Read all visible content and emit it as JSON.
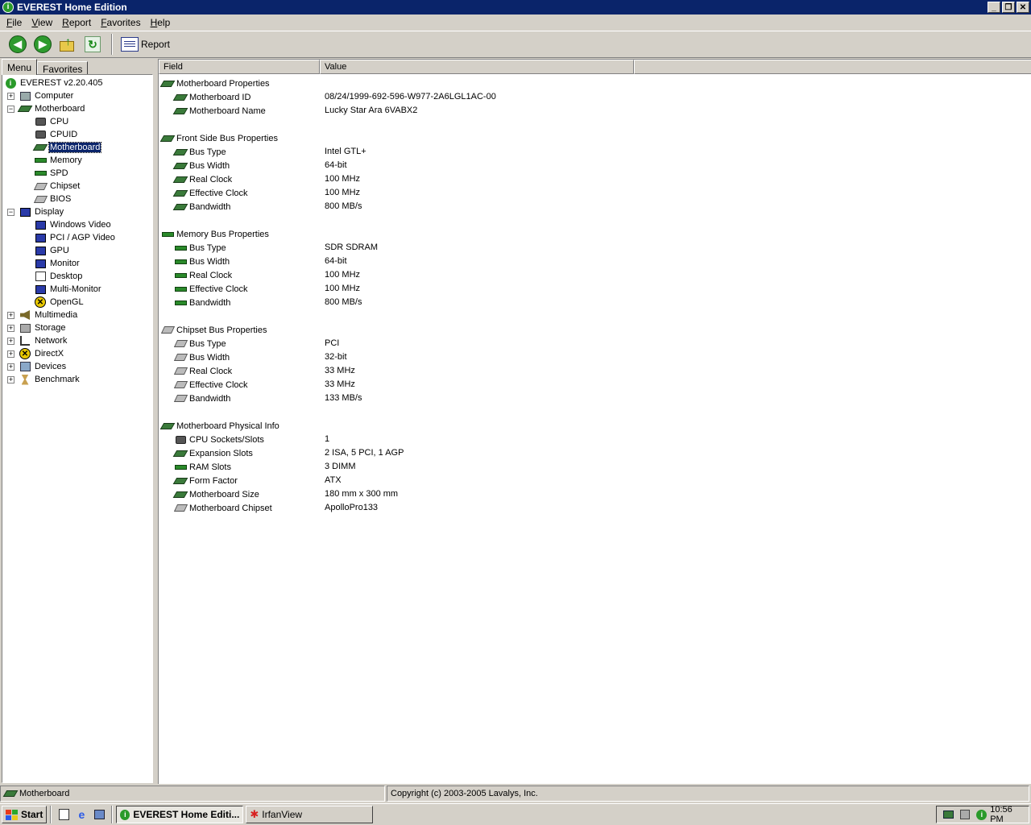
{
  "window": {
    "title": "EVEREST Home Edition"
  },
  "menu": [
    "File",
    "View",
    "Report",
    "Favorites",
    "Help"
  ],
  "toolbar": {
    "report_label": "Report"
  },
  "tabs": {
    "menu": "Menu",
    "favorites": "Favorites"
  },
  "tree": [
    {
      "label": "EVEREST v2.20.405",
      "icon": "info-icon"
    },
    {
      "label": "Computer",
      "icon": "computer-icon"
    },
    {
      "label": "Motherboard",
      "icon": "motherboard-icon"
    },
    {
      "label": "CPU",
      "icon": "cpu-icon"
    },
    {
      "label": "CPUID",
      "icon": "cpu-icon"
    },
    {
      "label": "Motherboard",
      "icon": "motherboard-icon"
    },
    {
      "label": "Memory",
      "icon": "ram-icon"
    },
    {
      "label": "SPD",
      "icon": "ram-icon"
    },
    {
      "label": "Chipset",
      "icon": "chipset-icon"
    },
    {
      "label": "BIOS",
      "icon": "chipset-icon"
    },
    {
      "label": "Display",
      "icon": "display-icon"
    },
    {
      "label": "Windows Video",
      "icon": "display-icon"
    },
    {
      "label": "PCI / AGP Video",
      "icon": "display-icon"
    },
    {
      "label": "GPU",
      "icon": "display-icon"
    },
    {
      "label": "Monitor",
      "icon": "display-icon"
    },
    {
      "label": "Desktop",
      "icon": "desktop-icon"
    },
    {
      "label": "Multi-Monitor",
      "icon": "display-icon"
    },
    {
      "label": "OpenGL",
      "icon": "opengl-icon"
    },
    {
      "label": "Multimedia",
      "icon": "speaker-icon"
    },
    {
      "label": "Storage",
      "icon": "storage-icon"
    },
    {
      "label": "Network",
      "icon": "network-icon"
    },
    {
      "label": "DirectX",
      "icon": "directx-icon"
    },
    {
      "label": "Devices",
      "icon": "devices-icon"
    },
    {
      "label": "Benchmark",
      "icon": "hourglass-icon"
    }
  ],
  "list": {
    "columns": [
      "Field",
      "Value"
    ],
    "rows": [
      {
        "field": "Motherboard Properties",
        "value": "",
        "icon": "motherboard-icon"
      },
      {
        "field": "Motherboard ID",
        "value": "08/24/1999-692-596-W977-2A6LGL1AC-00",
        "icon": "motherboard-icon"
      },
      {
        "field": "Motherboard Name",
        "value": "Lucky Star Ara 6VABX2",
        "icon": "motherboard-icon"
      },
      {
        "field": "Front Side Bus Properties",
        "value": "",
        "icon": "motherboard-icon"
      },
      {
        "field": "Bus Type",
        "value": "Intel GTL+",
        "icon": "motherboard-icon"
      },
      {
        "field": "Bus Width",
        "value": "64-bit",
        "icon": "motherboard-icon"
      },
      {
        "field": "Real Clock",
        "value": "100 MHz",
        "icon": "motherboard-icon"
      },
      {
        "field": "Effective Clock",
        "value": "100 MHz",
        "icon": "motherboard-icon"
      },
      {
        "field": "Bandwidth",
        "value": "800 MB/s",
        "icon": "motherboard-icon"
      },
      {
        "field": "Memory Bus Properties",
        "value": "",
        "icon": "ram-icon"
      },
      {
        "field": "Bus Type",
        "value": "SDR SDRAM",
        "icon": "ram-icon"
      },
      {
        "field": "Bus Width",
        "value": "64-bit",
        "icon": "ram-icon"
      },
      {
        "field": "Real Clock",
        "value": "100 MHz",
        "icon": "ram-icon"
      },
      {
        "field": "Effective Clock",
        "value": "100 MHz",
        "icon": "ram-icon"
      },
      {
        "field": "Bandwidth",
        "value": "800 MB/s",
        "icon": "ram-icon"
      },
      {
        "field": "Chipset Bus Properties",
        "value": "",
        "icon": "chipset-icon"
      },
      {
        "field": "Bus Type",
        "value": "PCI",
        "icon": "chipset-icon"
      },
      {
        "field": "Bus Width",
        "value": "32-bit",
        "icon": "chipset-icon"
      },
      {
        "field": "Real Clock",
        "value": "33 MHz",
        "icon": "chipset-icon"
      },
      {
        "field": "Effective Clock",
        "value": "33 MHz",
        "icon": "chipset-icon"
      },
      {
        "field": "Bandwidth",
        "value": "133 MB/s",
        "icon": "chipset-icon"
      },
      {
        "field": "Motherboard Physical Info",
        "value": "",
        "icon": "motherboard-icon"
      },
      {
        "field": "CPU Sockets/Slots",
        "value": "1",
        "icon": "cpu-icon"
      },
      {
        "field": "Expansion Slots",
        "value": "2 ISA, 5 PCI, 1 AGP",
        "icon": "motherboard-icon"
      },
      {
        "field": "RAM Slots",
        "value": "3 DIMM",
        "icon": "ram-icon"
      },
      {
        "field": "Form Factor",
        "value": "ATX",
        "icon": "motherboard-icon"
      },
      {
        "field": "Motherboard Size",
        "value": "180 mm x 300 mm",
        "icon": "motherboard-icon"
      },
      {
        "field": "Motherboard Chipset",
        "value": "ApolloPro133",
        "icon": "chipset-icon"
      }
    ]
  },
  "status": {
    "left": "Motherboard",
    "right": "Copyright (c) 2003-2005 Lavalys, Inc."
  },
  "taskbar": {
    "start": "Start",
    "tasks": [
      "EVEREST Home Editi...",
      "IrfanView"
    ],
    "clock": "10:56 PM"
  }
}
